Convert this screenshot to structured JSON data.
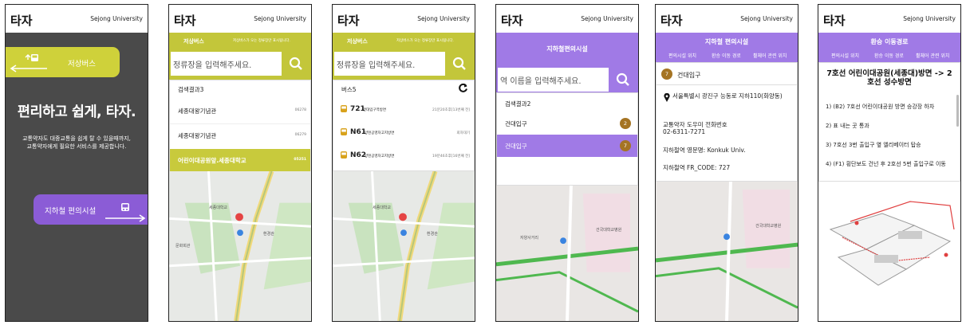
{
  "app_title": "타자",
  "university": "Sejong University",
  "colors": {
    "bus": "#c3c63a",
    "subway": "#a07ae6",
    "badge": "#a57423",
    "dark": "#4a4a4a"
  },
  "screen1": {
    "bus_label": "저상버스",
    "headline": "편리하고 쉽게, 타자.",
    "desc_line1": "교통약자도 대중교통을 쉽게 탈 수 있을때까지,",
    "desc_line2": "교통약자에게 필요한 서비스를 제공합니다.",
    "subway_label": "지하철 편의시설"
  },
  "screen2": {
    "bar_title": "저상버스",
    "bar_note": "저상버스가 오는 정류장만 표시됩니다.",
    "search_placeholder": "정류장을 입력해주세요.",
    "result_count": "검색결과3",
    "results": [
      {
        "name": "세종대왕기념관",
        "code": "06278"
      },
      {
        "name": "세종대왕기념관",
        "code": "06279"
      },
      {
        "name": "어린이대공원앞.세종대학교",
        "code": "05251"
      }
    ]
  },
  "screen3": {
    "bar_title": "저상버스",
    "bar_note": "저상버스가 오는 정류장만 표시됩니다.",
    "search_value": "정류장을 입력해주세요.",
    "bus_count": "버스5",
    "buses": [
      {
        "num": "721",
        "dest": "건대입구역방면",
        "info": "21분20초후[13번째 전]"
      },
      {
        "num": "N61",
        "dest": "양천공영차고지방면",
        "info": "회차대기"
      },
      {
        "num": "N62",
        "dest": "양천공영차고지방면",
        "info": "19분46초후[16번째 전]"
      }
    ]
  },
  "screen4": {
    "header": "지하철편의시설",
    "search_placeholder": "역 이름을 입력해주세요.",
    "result_count": "검색결과2",
    "results": [
      {
        "name": "건대입구",
        "line": "2"
      },
      {
        "name": "건대입구",
        "line": "7"
      }
    ]
  },
  "screen5": {
    "header": "지하철 편의시설",
    "tabs": [
      "편의시설 위치",
      "환승 이동 경로",
      "휠체어 관련 위치"
    ],
    "station_line": "7",
    "station": "건대입구",
    "address": "서울특별시 광진구 능동로 지하110(화양동)",
    "phone_label": "교통약자 도우미 전화번호",
    "phone": "02-6311-7271",
    "english_name": "지하철역 영문명: Konkuk Univ.",
    "fr_code": "지하철역 FR_CODE: 727"
  },
  "screen6": {
    "header": "환승 이동경로",
    "tabs": [
      "편의시설 위치",
      "환승 이동 경로",
      "휠체어 관련 위치"
    ],
    "route_title": "7호선 어린이대공원(세종대)방면 -> 2호선 성수방면",
    "steps": [
      "1) (B2) 7호선 어린이대공원 방면 승강장 하차",
      "2) 표 내는 곳 통과",
      "3) 7호선 3번 출입구 옆 엘리베이터 탑승",
      "4) (F1) 횡단보도 건넌 후 2호선 5번 출입구로 이동"
    ]
  }
}
